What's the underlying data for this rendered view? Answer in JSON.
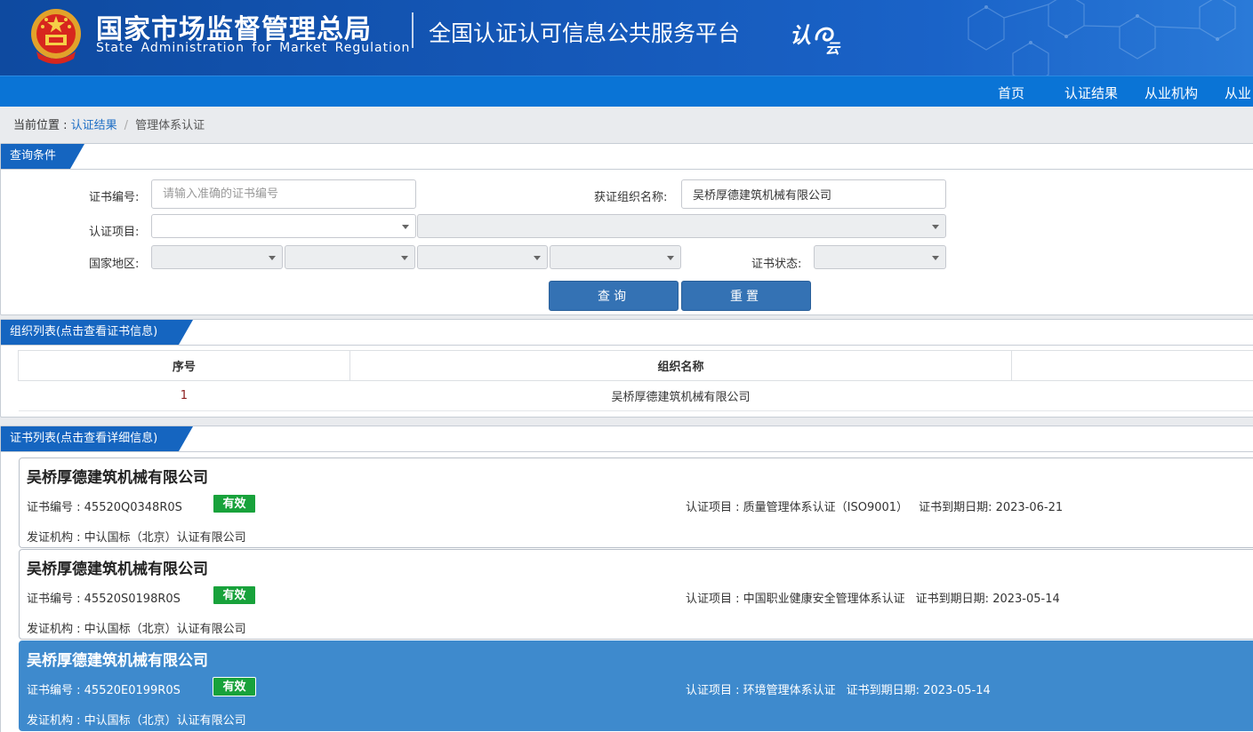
{
  "header": {
    "agency_cn": "国家市场监督管理总局",
    "agency_en": "State Administration  for  Market Regulation",
    "platform": "全国认证认可信息公共服务平台",
    "logo_text": "认e云"
  },
  "nav": {
    "items": [
      "首页",
      "认证结果",
      "从业机构",
      "从业"
    ]
  },
  "breadcrumb": {
    "prefix": "当前位置 :",
    "link": "认证结果",
    "sep": "/",
    "current": "管理体系认证"
  },
  "query": {
    "title": "查询条件",
    "cert_no_label": "证书编号:",
    "cert_no_placeholder": "请输入准确的证书编号",
    "org_name_label": "获证组织名称:",
    "org_name_value": "吴桥厚德建筑机械有限公司",
    "project_label": "认证项目:",
    "region_label": "国家地区:",
    "status_label": "证书状态:",
    "search_btn": "查询",
    "reset_btn": "重置"
  },
  "org_list": {
    "title": "组织列表(点击查看证书信息)",
    "headers": [
      "序号",
      "组织名称"
    ],
    "rows": [
      {
        "idx": "1",
        "name": "吴桥厚德建筑机械有限公司"
      }
    ]
  },
  "cert_list": {
    "title": "证书列表(点击查看详细信息)",
    "no_label": "证书编号 : ",
    "project_label": "认证项目 : ",
    "expiry_label": "证书到期日期: ",
    "issuer_label": "发证机构 : ",
    "items": [
      {
        "name": "吴桥厚德建筑机械有限公司",
        "no": "45520Q0348R0S",
        "status": "有效",
        "project": "质量管理体系认证（ISO9001）",
        "expiry": "2023-06-21",
        "issuer": "中认国标（北京）认证有限公司"
      },
      {
        "name": "吴桥厚德建筑机械有限公司",
        "no": "45520S0198R0S",
        "status": "有效",
        "project": "中国职业健康安全管理体系认证",
        "expiry": "2023-05-14",
        "issuer": "中认国标（北京）认证有限公司"
      },
      {
        "name": "吴桥厚德建筑机械有限公司",
        "no": "45520E0199R0S",
        "status": "有效",
        "project": "环境管理体系认证",
        "expiry": "2023-05-14",
        "issuer": "中认国标（北京）认证有限公司"
      }
    ]
  },
  "colors": {
    "header_blue": "#1558b8",
    "nav_blue": "#0a74d6",
    "tab_blue": "#1565c0",
    "button_blue": "#3472b4",
    "valid_green": "#18a23b",
    "active_card": "#3e8acd"
  }
}
